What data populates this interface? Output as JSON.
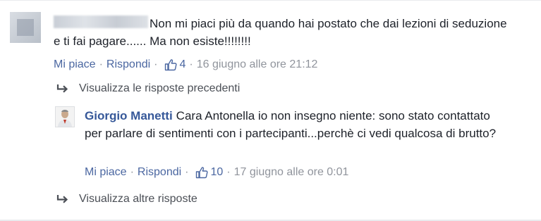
{
  "comment": {
    "text": "Non mi piaci più da quando hai postato che dai lezioni di seduzione e ti fai pagare...... Ma non esiste!!!!!!!!",
    "like_label": "Mi piace",
    "reply_label": "Rispondi",
    "likes": "4",
    "timestamp": "16 giugno alle ore 21:12",
    "separator": "·"
  },
  "view_previous": "Visualizza le risposte precedenti",
  "reply": {
    "author": "Giorgio Manetti",
    "text": "Cara Antonella io non insegno niente: sono stato contattato per parlare di sentimenti con i partecipanti...perchè ci vedi qualcosa di brutto?",
    "like_label": "Mi piace",
    "reply_label": "Rispondi",
    "likes": "10",
    "timestamp": "17 giugno alle ore 0:01",
    "separator": "·"
  },
  "view_more": "Visualizza altre risposte",
  "colors": {
    "link": "#4b67a1",
    "author": "#365899",
    "meta": "#90949c"
  },
  "icons": {
    "like": "thumbs-up-icon",
    "reply_arrow": "reply-arrow-icon"
  }
}
